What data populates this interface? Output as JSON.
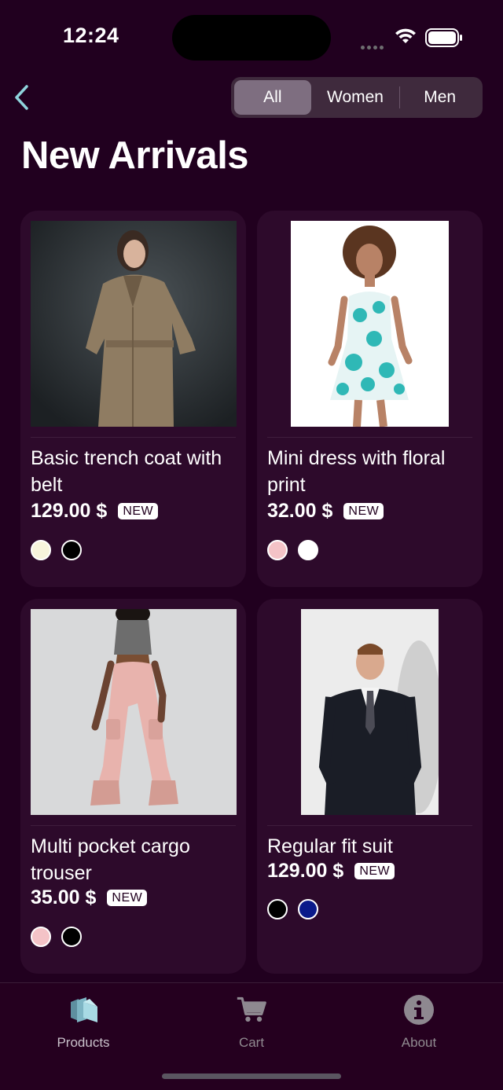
{
  "status_bar": {
    "time": "12:24"
  },
  "nav": {
    "segments": [
      "All",
      "Women",
      "Men"
    ],
    "selected_segment": "All"
  },
  "page": {
    "title": "New Arrivals"
  },
  "products": [
    {
      "name": "Basic trench coat with belt",
      "price": "129.00 $",
      "badge": "NEW",
      "image": "trench-coat-photo",
      "colors": [
        "#f7f4dc",
        "#000000"
      ]
    },
    {
      "name": "Mini dress with floral print",
      "price": "32.00 $",
      "badge": "NEW",
      "image": "floral-dress-photo",
      "colors": [
        "#f4c3c7",
        "#ffffff"
      ]
    },
    {
      "name": "Multi pocket cargo trouser",
      "price": "35.00 $",
      "badge": "NEW",
      "image": "cargo-trouser-photo",
      "colors": [
        "#f4c3c7",
        "#000000"
      ]
    },
    {
      "name": "Regular fit suit",
      "price": "129.00 $",
      "badge": "NEW",
      "image": "suit-photo",
      "colors": [
        "#000000",
        "#0a1a8a"
      ]
    }
  ],
  "tab_bar": {
    "items": [
      {
        "label": "Products",
        "icon": "products-icon",
        "active": true
      },
      {
        "label": "Cart",
        "icon": "cart-icon",
        "active": false
      },
      {
        "label": "About",
        "icon": "info-icon",
        "active": false
      }
    ]
  },
  "colors": {
    "background": "#21001f",
    "card": "#2d0a2b",
    "accent": "#7e6e80"
  }
}
